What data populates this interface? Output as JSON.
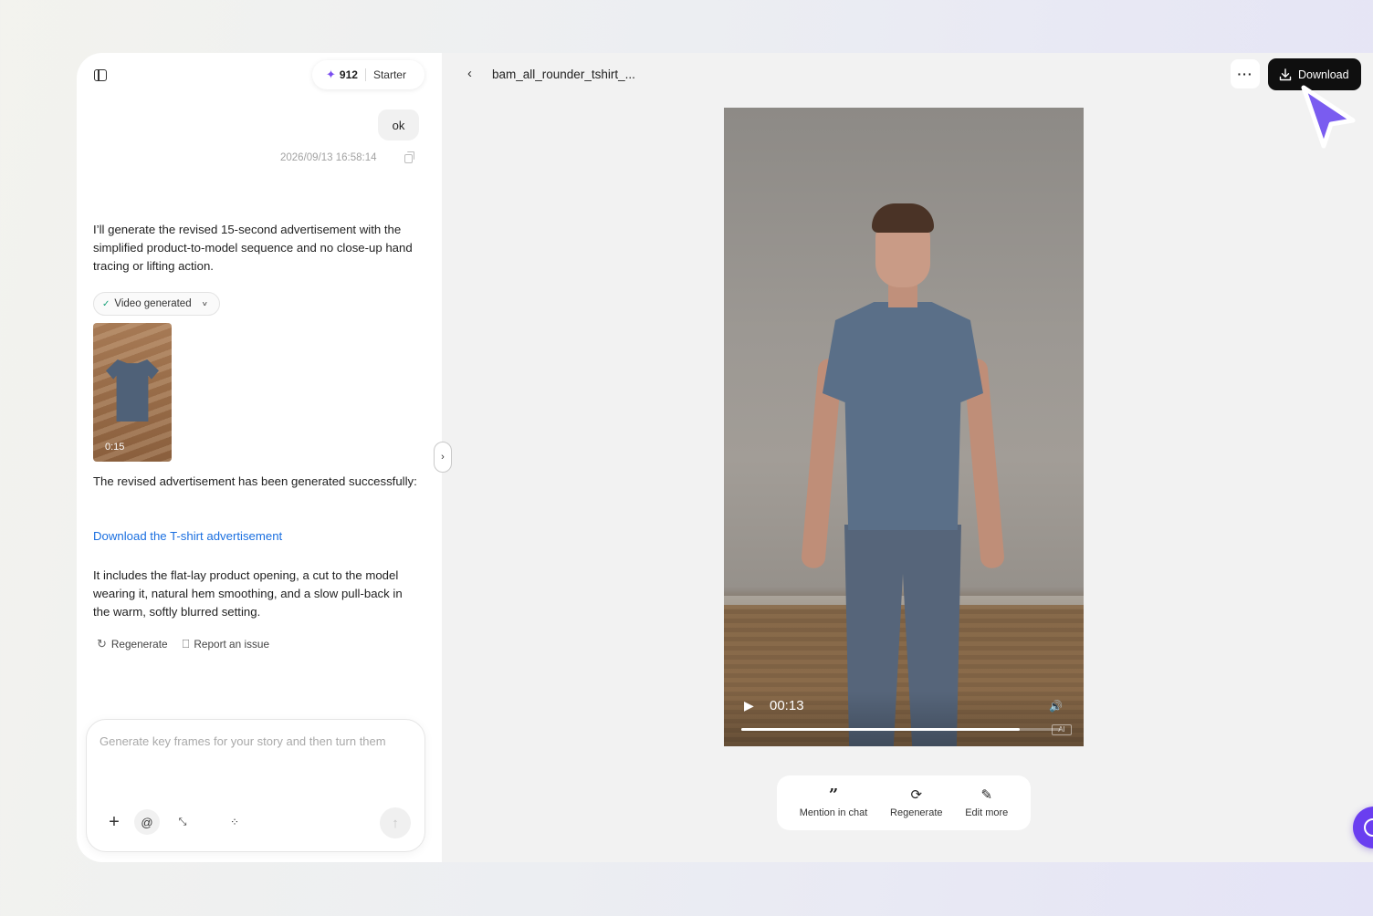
{
  "header": {
    "credits": "912",
    "plan": "Starter"
  },
  "chat": {
    "user_message": "ok",
    "timestamp": "2026/09/13 16:58:14",
    "assistant_intro": "I’ll generate the revised 15-second advertisement with the simplified product-to-model sequence and no close-up hand tracing or lifting action.",
    "status_chip": "Video generated",
    "thumbnail_duration": "0:15",
    "success_text": "The revised advertisement has been generated successfully:",
    "download_link": "Download the T-shirt advertisement",
    "description": "It includes the flat-lay product opening, a cut to the model wearing it, natural hem smoothing, and a slow pull-back in the warm, softly blurred setting.",
    "actions": {
      "regenerate": "Regenerate",
      "report": "Report an issue"
    }
  },
  "composer": {
    "placeholder": "Generate key frames for your story and then turn them",
    "at_label": "@"
  },
  "preview": {
    "file_title": "bam_all_rounder_tshirt_...",
    "more_label": "···",
    "download_label": "Download",
    "video": {
      "current_time": "00:13",
      "progress_fraction": 0.87,
      "badge": "AI"
    },
    "toolbar": {
      "mention": "Mention in chat",
      "regenerate": "Regenerate",
      "edit": "Edit more"
    }
  },
  "colors": {
    "accent": "#7a4df0",
    "link": "#1a6fe0",
    "download_bg": "#0f0f0f",
    "fab": "#6a3ef0"
  }
}
